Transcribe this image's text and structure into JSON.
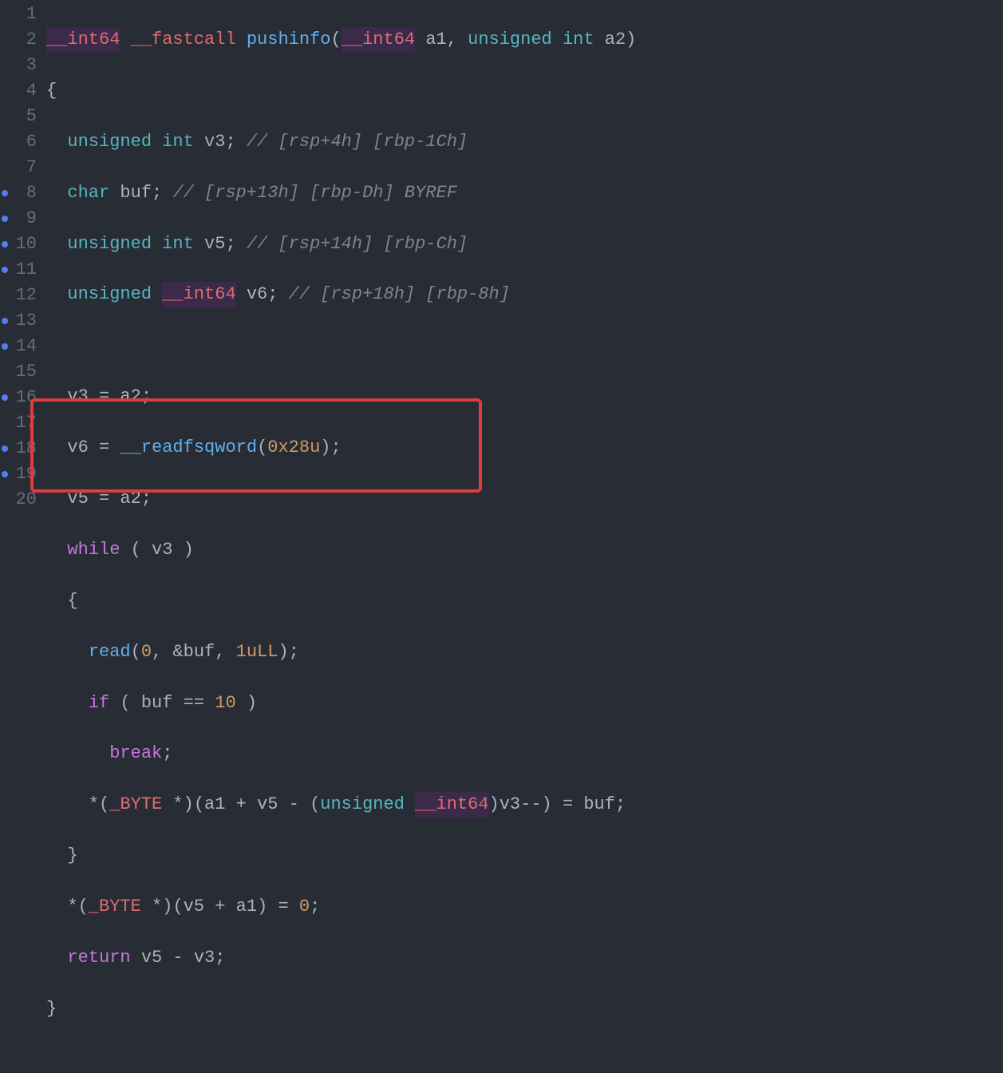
{
  "lines": [
    {
      "n": "1",
      "bp": false
    },
    {
      "n": "2",
      "bp": false
    },
    {
      "n": "3",
      "bp": false
    },
    {
      "n": "4",
      "bp": false
    },
    {
      "n": "5",
      "bp": false
    },
    {
      "n": "6",
      "bp": false
    },
    {
      "n": "7",
      "bp": false
    },
    {
      "n": "8",
      "bp": true
    },
    {
      "n": "9",
      "bp": true
    },
    {
      "n": "10",
      "bp": true
    },
    {
      "n": "11",
      "bp": true
    },
    {
      "n": "12",
      "bp": false
    },
    {
      "n": "13",
      "bp": true
    },
    {
      "n": "14",
      "bp": true
    },
    {
      "n": "15",
      "bp": false
    },
    {
      "n": "16",
      "bp": true
    },
    {
      "n": "17",
      "bp": false
    },
    {
      "n": "18",
      "bp": true
    },
    {
      "n": "19",
      "bp": true
    },
    {
      "n": "20",
      "bp": false
    }
  ],
  "code": {
    "t_int64": "__int64",
    "t_fastcall": "__fastcall",
    "fn_name": "pushinfo",
    "p1": "a1",
    "p2": "a2",
    "t_unsigned": "unsigned",
    "t_int": "int",
    "t_char": "char",
    "v3": "v3",
    "v5": "v5",
    "v6": "v6",
    "buf": "buf",
    "c_l3": "// [rsp+4h] [rbp-1Ch]",
    "c_l4": "// [rsp+13h] [rbp-Dh] BYREF",
    "c_l5": "// [rsp+14h] [rbp-Ch]",
    "c_l6": "// [rsp+18h] [rbp-8h]",
    "kw_while": "while",
    "kw_if": "if",
    "kw_break": "break",
    "kw_return": "return",
    "fn_read": "read",
    "fn_readfsq": "__readfsqword",
    "num_0": "0",
    "num_10": "10",
    "num_1ull": "1uLL",
    "num_0x28u": "0x28u",
    "t_byte": "_BYTE"
  }
}
